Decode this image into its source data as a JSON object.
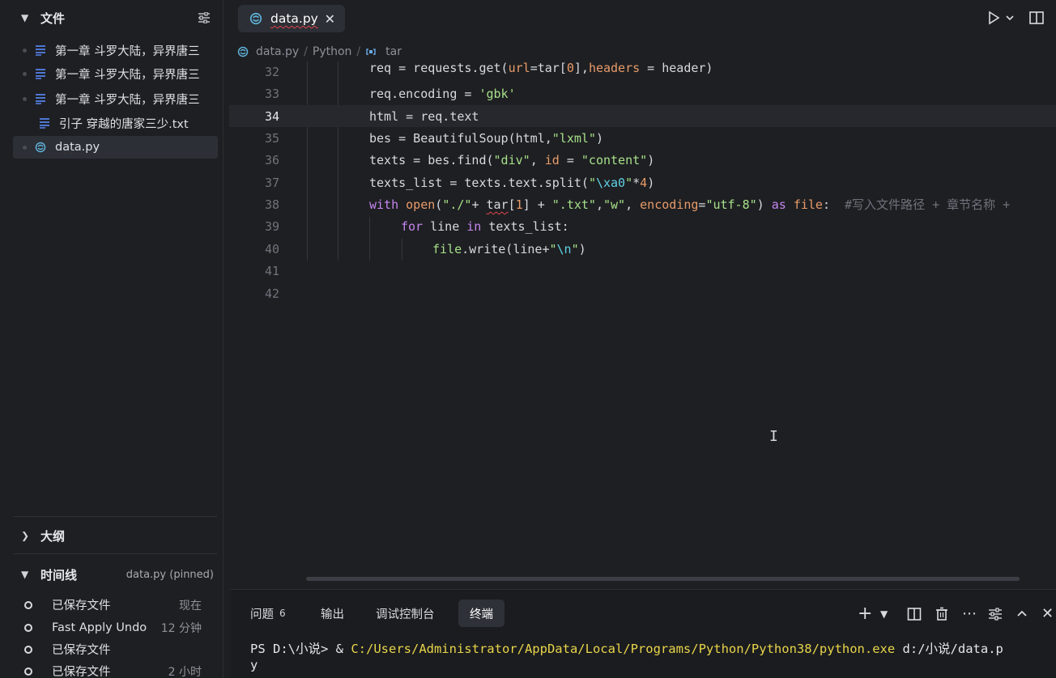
{
  "sidebar": {
    "files_title": "文件",
    "files": [
      {
        "name": "第一章 斗罗大陆，异界唐三",
        "icon": "text-file-icon"
      },
      {
        "name": "第一章 斗罗大陆，异界唐三",
        "icon": "text-file-icon"
      },
      {
        "name": "第一章 斗罗大陆，异界唐三",
        "icon": "text-file-icon"
      },
      {
        "name": "引子 穿越的唐家三少.txt",
        "icon": "text-file-icon"
      },
      {
        "name": "data.py",
        "icon": "python-file-icon"
      }
    ],
    "outline_title": "大纲",
    "timeline_title": "时间线",
    "timeline_pinned": "data.py (pinned)",
    "timeline": [
      {
        "label": "已保存文件",
        "time": "现在"
      },
      {
        "label": "Fast Apply Undo",
        "time": "12 分钟"
      },
      {
        "label": "已保存文件",
        "time": ""
      },
      {
        "label": "已保存文件",
        "time": "2 小时"
      }
    ]
  },
  "editor": {
    "tab_label": "data.py",
    "breadcrumb": {
      "file": "data.py",
      "lang": "Python",
      "symbol": "tar"
    },
    "line_numbers": [
      "32",
      "33",
      "34",
      "35",
      "36",
      "37",
      "38",
      "39",
      "40",
      "41",
      "42"
    ],
    "current_line": "34",
    "lines": [
      "req = requests.get(url=tar[0],headers = header)",
      "req.encoding = 'gbk'",
      "html = req.text",
      "bes = BeautifulSoup(html,\"lxml\")",
      "texts = bes.find(\"div\", id = \"content\")",
      "texts_list = texts.text.split(\"\\xa0\"*4)",
      "with open(\"./\"+ tar[1] + \".txt\",\"w\", encoding=\"utf-8\") as file:  #写入文件路径 + 章节名称 +",
      "for line in texts_list:",
      "file.write(line+\"\\n\")",
      "",
      ""
    ]
  },
  "panel": {
    "tabs": [
      {
        "label": "问题",
        "badge": "6"
      },
      {
        "label": "输出"
      },
      {
        "label": "调试控制台"
      },
      {
        "label": "终端"
      }
    ],
    "terminal": {
      "prompt": "PS D:\\小说> & ",
      "exe_path": "C:/Users/Administrator/AppData/Local/Programs/Python/Python38/python.exe",
      "args": " d:/小说/data.p",
      "wrap": "y"
    }
  }
}
